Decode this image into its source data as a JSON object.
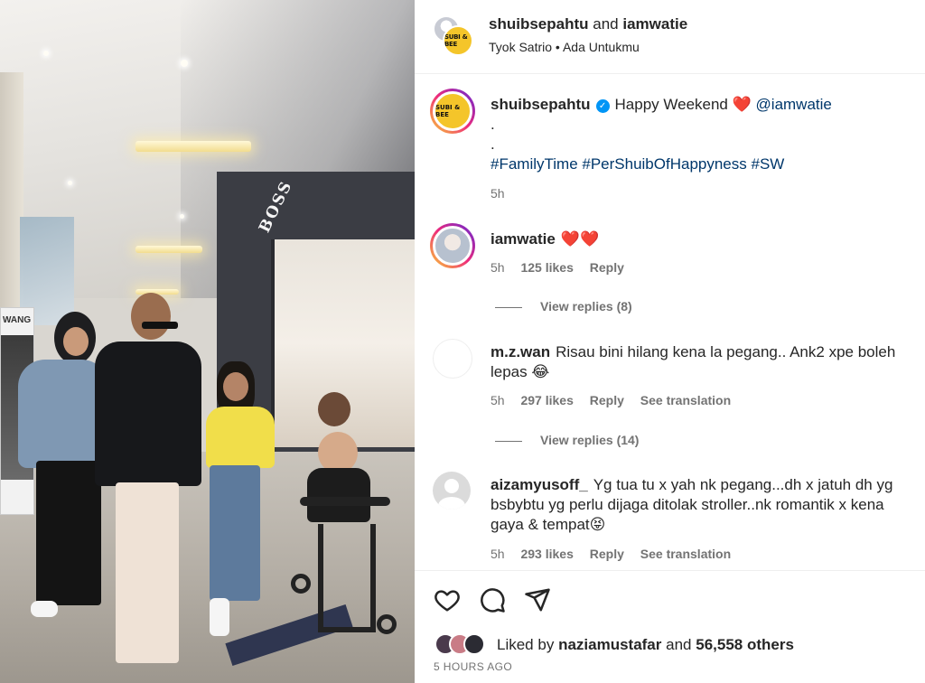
{
  "header": {
    "user1": "shuibsepahtu",
    "connector": "and",
    "user2": "iamwatie",
    "artist": "Tyok Satrio",
    "separator": "•",
    "song": "Ada Untukmu",
    "avatar_badge": "SUBI & BEE"
  },
  "caption": {
    "username": "shuibsepahtu",
    "verified_icon": "verified-badge-icon",
    "text": "Happy Weekend",
    "emoji": "❤️",
    "mention": "@iamwatie",
    "dot1": ".",
    "dot2": ".",
    "hashtags": "#FamilyTime #PerShuibOfHappyness #SW",
    "time": "5h",
    "avatar_badge": "SUBI & BEE"
  },
  "comments": [
    {
      "username": "iamwatie",
      "text": "❤️❤️",
      "time": "5h",
      "likes": "125 likes",
      "reply": "Reply",
      "view_replies": "View replies (8)"
    },
    {
      "username": "m.z.wan",
      "text": "Risau bini hilang kena la pegang.. Ank2 xpe boleh lepas 😂",
      "time": "5h",
      "likes": "297 likes",
      "reply": "Reply",
      "translate": "See translation",
      "view_replies": "View replies (14)"
    },
    {
      "username": "aizamyusoff_",
      "text": "Yg tua tu x yah nk pegang...dh x jatuh dh yg bsbybtu yg perlu dijaga ditolak stroller..nk romantik x kena gaya & tempat😝",
      "time": "5h",
      "likes": "293 likes",
      "reply": "Reply",
      "translate": "See translation"
    }
  ],
  "actions": {
    "like_icon": "heart-icon",
    "comment_icon": "comment-icon",
    "share_icon": "share-icon"
  },
  "likes": {
    "prefix": "Liked by",
    "user": "naziamustafar",
    "connector": "and",
    "others": "56,558 others"
  },
  "timestamp": "5 HOURS AGO",
  "media": {
    "store_sign": "BOSS",
    "poster_text": "WANG"
  },
  "colors": {
    "link": "#00376b",
    "verified": "#0095f6",
    "heart": "#ed1c24",
    "muted": "#737373",
    "text": "#262626"
  }
}
